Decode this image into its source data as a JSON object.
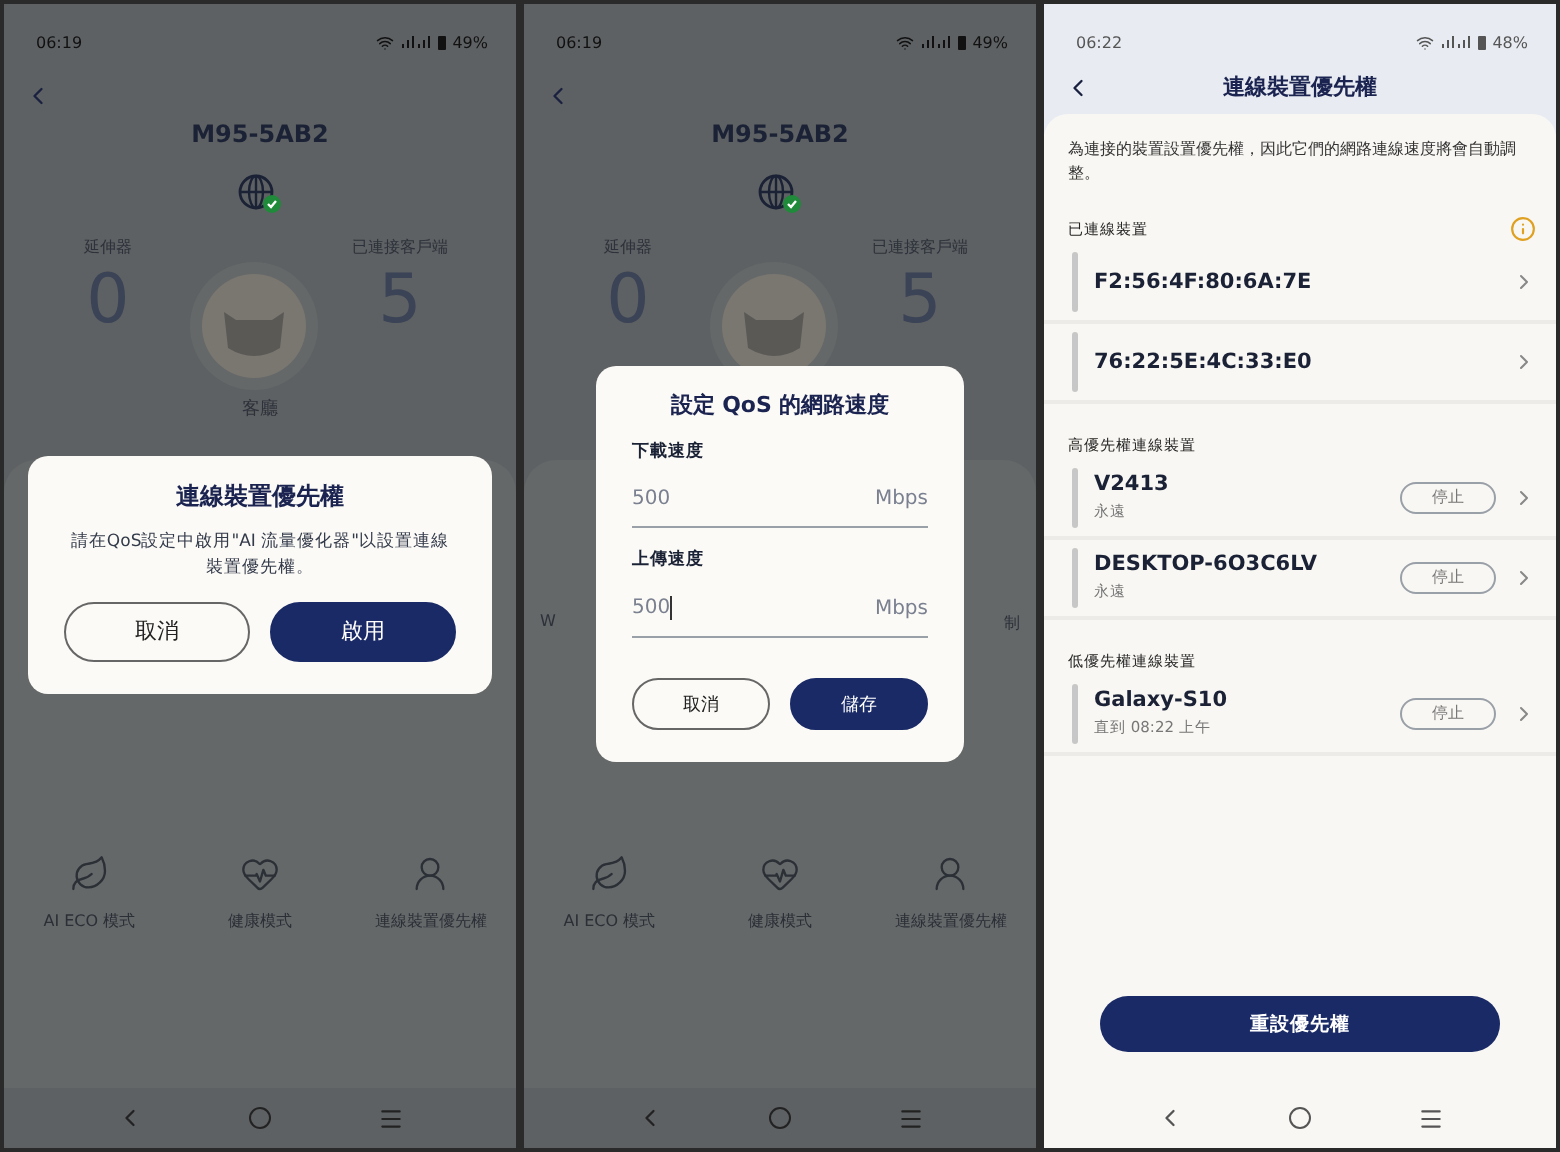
{
  "screens": [
    {
      "kind": "message_dialog",
      "status_bar": {
        "time": "06:19",
        "battery": "49%"
      },
      "title": "M95-5AB2",
      "stats": [
        {
          "label": "延伸器",
          "value": "0"
        },
        {
          "label": "已連接客戶端",
          "value": "5"
        }
      ],
      "location": "客廳",
      "features": [
        {
          "kind": "eco",
          "label": "AI ECO 模式"
        },
        {
          "kind": "health",
          "label": "健康模式"
        },
        {
          "kind": "priority",
          "label": "連線裝置優先權"
        }
      ],
      "dialog": {
        "kind": "message",
        "title": "連線裝置優先權",
        "message": "請在QoS設定中啟用\"AI 流量優化器\"以設置連線裝置優先權。",
        "buttons": [
          {
            "label": "取消",
            "primary": false
          },
          {
            "label": "啟用",
            "primary": true
          }
        ]
      }
    },
    {
      "kind": "form_dialog",
      "status_bar": {
        "time": "06:19",
        "battery": "49%"
      },
      "title": "M95-5AB2",
      "stats": [
        {
          "label": "延伸器",
          "value": "0"
        },
        {
          "label": "已連接客戶端",
          "value": "5"
        }
      ],
      "behind_fragments": [
        "W",
        "制"
      ],
      "features": [
        {
          "kind": "eco",
          "label": "AI ECO 模式"
        },
        {
          "kind": "health",
          "label": "健康模式"
        },
        {
          "kind": "priority",
          "label": "連線裝置優先權"
        }
      ],
      "dialog": {
        "kind": "form",
        "title": "設定 QoS 的網路速度",
        "fields": [
          {
            "label": "下載速度",
            "value": "500",
            "unit": "Mbps",
            "focused": false
          },
          {
            "label": "上傳速度",
            "value": "500",
            "unit": "Mbps",
            "focused": true
          }
        ],
        "buttons": [
          {
            "label": "取消",
            "primary": false
          },
          {
            "label": "儲存",
            "primary": true
          }
        ]
      }
    },
    {
      "kind": "list",
      "status_bar": {
        "time": "06:22",
        "battery": "48%"
      },
      "title": "連線裝置優先權",
      "description": "為連接的裝置設置優先權，因此它們的網路連線速度將會自動調整。",
      "sections": [
        {
          "title": "已連線裝置",
          "info": true,
          "devices": [
            {
              "name": "F2:56:4F:80:6A:7E"
            },
            {
              "name": "76:22:5E:4C:33:E0"
            }
          ]
        },
        {
          "title": "高優先權連線裝置",
          "info": false,
          "devices": [
            {
              "name": "V2413",
              "note": "永遠",
              "action": "停止"
            },
            {
              "name": "DESKTOP-6O3C6LV",
              "note": "永遠",
              "action": "停止"
            }
          ]
        },
        {
          "title": "低優先權連線裝置",
          "info": false,
          "devices": [
            {
              "name": "Galaxy-S10",
              "note": "直到 08:22 上午",
              "action": "停止"
            }
          ]
        }
      ],
      "reset_button": "重設優先權"
    }
  ]
}
